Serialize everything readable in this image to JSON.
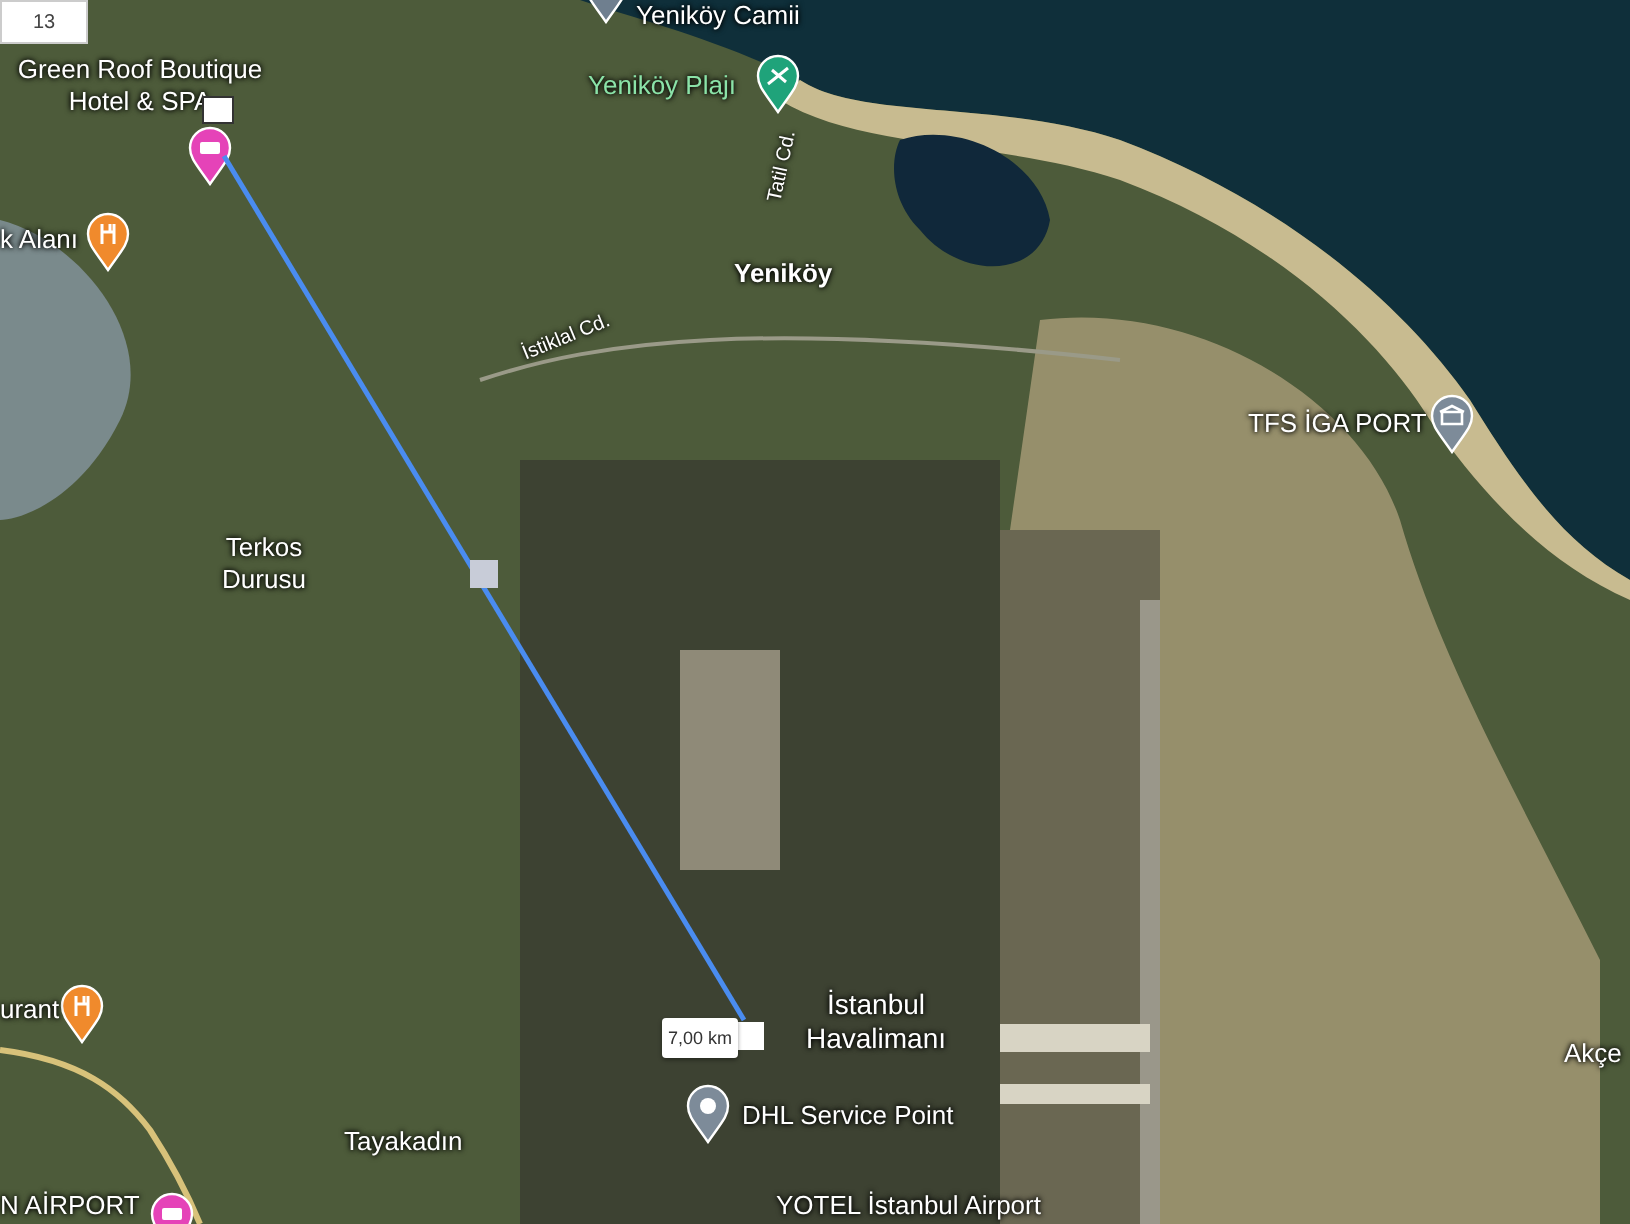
{
  "zoom_level": "13",
  "measurement": {
    "distance": "7,00 km"
  },
  "places": [
    {
      "label": "Yeniköy Camii",
      "kind": "worship"
    },
    {
      "label": "Green Roof Boutique Hotel & SPA",
      "kind": "hotel"
    },
    {
      "label": "k Alanı",
      "kind": "restaurant"
    },
    {
      "label": "Yeniköy Plajı",
      "kind": "beach"
    },
    {
      "label": "TFS İGA PORT",
      "kind": "port"
    },
    {
      "label": "urant",
      "kind": "restaurant"
    },
    {
      "label": "DHL Service Point",
      "kind": "service"
    },
    {
      "label": "N AİRPORT",
      "kind": "hotel"
    }
  ],
  "areas": [
    {
      "label": "Yeniköy"
    },
    {
      "label": "Terkos Durusu"
    },
    {
      "label": "Tayakadın"
    },
    {
      "label": "İstanbul Havalimanı"
    },
    {
      "label": "YOTEL İstanbul Airport"
    },
    {
      "label": "Akçe"
    }
  ],
  "streets": [
    {
      "label": "Tatil Cd."
    },
    {
      "label": "İstiklal Cd."
    }
  ]
}
